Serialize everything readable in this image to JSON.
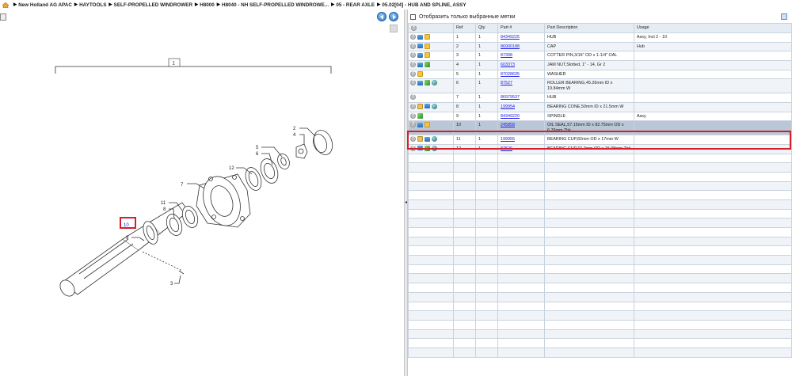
{
  "breadcrumb": [
    "New Holland AG APAC",
    "HAYTOOLS",
    "SELF-PROPELLED WINDROWER",
    "H8000",
    "H8040 - NH SELF-PROPELLED WINDROWE...",
    "05 - REAR AXLE",
    "05.02[04] - HUB AND SPLINE, ASSY"
  ],
  "filter": {
    "label": "Отобразить только выбранные метки"
  },
  "table": {
    "headers": [
      "",
      "Ref",
      "Qty",
      "Part #",
      "Part Description",
      "Usage"
    ],
    "rows": [
      {
        "icons": [
          "plus",
          "cart",
          "note"
        ],
        "ref": "1",
        "qty": "1",
        "part": "84349225",
        "desc": "HUB",
        "usage": "Assy, Incl 2 - 10"
      },
      {
        "icons": [
          "plus",
          "cart",
          "note"
        ],
        "ref": "2",
        "qty": "1",
        "part": "86900188",
        "desc": "CAP",
        "usage": "Hub"
      },
      {
        "icons": [
          "plus",
          "cart",
          "note"
        ],
        "ref": "3",
        "qty": "1",
        "part": "87398",
        "desc": "COTTER PIN,3/16\" OD x 1-1/4\" OAL",
        "usage": ""
      },
      {
        "icons": [
          "plus",
          "cart",
          "green"
        ],
        "ref": "4",
        "qty": "1",
        "part": "603373",
        "desc": "JAM NUT,Slotted, 1\" - 14, Gr 2",
        "usage": ""
      },
      {
        "icons": [
          "plus",
          "note"
        ],
        "ref": "5",
        "qty": "1",
        "part": "87028635",
        "desc": "WASHER",
        "usage": ""
      },
      {
        "icons": [
          "plus",
          "cart",
          "green",
          "globe"
        ],
        "ref": "6",
        "qty": "1",
        "part": "87527",
        "desc": "ROLLER BEARING,45.26mm ID x 19.84mm W",
        "usage": ""
      },
      {
        "icons": [
          "plus"
        ],
        "ref": "7",
        "qty": "1",
        "part": "86979537",
        "desc": "HUB",
        "usage": ""
      },
      {
        "icons": [
          "plus",
          "folder",
          "cart",
          "globe"
        ],
        "ref": "8",
        "qty": "1",
        "part": "199954",
        "desc": "BEARING CONE,50mm ID x 21.5mm W",
        "usage": ""
      },
      {
        "icons": [
          "plus",
          "green"
        ],
        "ref": "9",
        "qty": "1",
        "part": "84349220",
        "desc": "SPINDLE",
        "usage": "Assy"
      },
      {
        "icons": [
          "plus",
          "cart",
          "note"
        ],
        "ref": "10",
        "qty": "1",
        "part": "245858",
        "desc": "OIL SEAL,57.15mm ID x 82.75mm OD x 6.76mm Thk",
        "usage": "",
        "selected": true
      },
      {
        "icons": [
          "plus",
          "folder",
          "cart",
          "globe"
        ],
        "ref": "11",
        "qty": "1",
        "part": "199955",
        "desc": "BEARING CUP,82mm OD x 17mm W",
        "usage": ""
      },
      {
        "icons": [
          "plus",
          "cart",
          "green",
          "globe"
        ],
        "ref": "12",
        "qty": "1",
        "part": "87526",
        "desc": "BEARING CUP,77.7mm OD x 15.08mm Thk",
        "usage": ""
      }
    ],
    "empty_rows": 22
  },
  "diagram": {
    "callouts": [
      "1",
      "2",
      "4",
      "5",
      "6",
      "12",
      "7",
      "11",
      "8",
      "10",
      "9",
      "3"
    ]
  },
  "colors": {
    "selection": "#d3202a",
    "link": "#1a1ae6",
    "header_bg": "#e6ecf3"
  }
}
